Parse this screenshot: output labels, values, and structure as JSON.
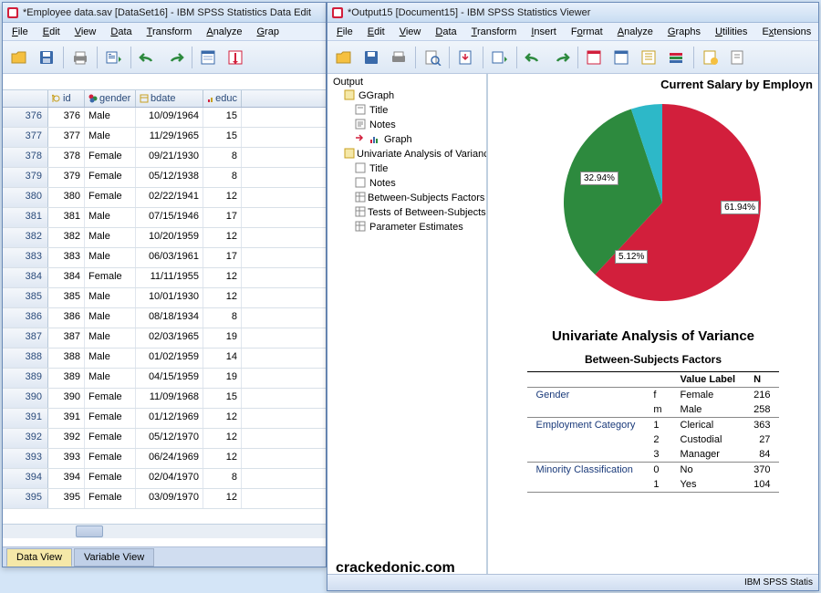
{
  "watermark": "crackedonic.com",
  "data_editor": {
    "title": "*Employee data.sav [DataSet16] - IBM SPSS Statistics Data Edit",
    "menu": [
      "File",
      "Edit",
      "View",
      "Data",
      "Transform",
      "Analyze",
      "Grap"
    ],
    "columns": [
      "id",
      "gender",
      "bdate",
      "educ"
    ],
    "rows": [
      {
        "n": 376,
        "id": 376,
        "gender": "Male",
        "bdate": "10/09/1964",
        "educ": 15
      },
      {
        "n": 377,
        "id": 377,
        "gender": "Male",
        "bdate": "11/29/1965",
        "educ": 15
      },
      {
        "n": 378,
        "id": 378,
        "gender": "Female",
        "bdate": "09/21/1930",
        "educ": 8
      },
      {
        "n": 379,
        "id": 379,
        "gender": "Female",
        "bdate": "05/12/1938",
        "educ": 8
      },
      {
        "n": 380,
        "id": 380,
        "gender": "Female",
        "bdate": "02/22/1941",
        "educ": 12
      },
      {
        "n": 381,
        "id": 381,
        "gender": "Male",
        "bdate": "07/15/1946",
        "educ": 17
      },
      {
        "n": 382,
        "id": 382,
        "gender": "Male",
        "bdate": "10/20/1959",
        "educ": 12
      },
      {
        "n": 383,
        "id": 383,
        "gender": "Male",
        "bdate": "06/03/1961",
        "educ": 17
      },
      {
        "n": 384,
        "id": 384,
        "gender": "Female",
        "bdate": "11/11/1955",
        "educ": 12
      },
      {
        "n": 385,
        "id": 385,
        "gender": "Male",
        "bdate": "10/01/1930",
        "educ": 12
      },
      {
        "n": 386,
        "id": 386,
        "gender": "Male",
        "bdate": "08/18/1934",
        "educ": 8
      },
      {
        "n": 387,
        "id": 387,
        "gender": "Male",
        "bdate": "02/03/1965",
        "educ": 19
      },
      {
        "n": 388,
        "id": 388,
        "gender": "Male",
        "bdate": "01/02/1959",
        "educ": 14
      },
      {
        "n": 389,
        "id": 389,
        "gender": "Male",
        "bdate": "04/15/1959",
        "educ": 19
      },
      {
        "n": 390,
        "id": 390,
        "gender": "Female",
        "bdate": "11/09/1968",
        "educ": 15
      },
      {
        "n": 391,
        "id": 391,
        "gender": "Female",
        "bdate": "01/12/1969",
        "educ": 12
      },
      {
        "n": 392,
        "id": 392,
        "gender": "Female",
        "bdate": "05/12/1970",
        "educ": 12
      },
      {
        "n": 393,
        "id": 393,
        "gender": "Female",
        "bdate": "06/24/1969",
        "educ": 12
      },
      {
        "n": 394,
        "id": 394,
        "gender": "Female",
        "bdate": "02/04/1970",
        "educ": 8
      },
      {
        "n": 395,
        "id": 395,
        "gender": "Female",
        "bdate": "03/09/1970",
        "educ": 12
      }
    ],
    "tabs": {
      "active": "Data View",
      "inactive": "Variable View"
    }
  },
  "viewer": {
    "title": "*Output15 [Document15] - IBM SPSS Statistics Viewer",
    "menu": [
      "File",
      "Edit",
      "View",
      "Data",
      "Transform",
      "Insert",
      "Format",
      "Analyze",
      "Graphs",
      "Utilities",
      "Extensions"
    ],
    "outline": {
      "root": "Output",
      "ggraph": {
        "label": "GGraph",
        "children": [
          "Title",
          "Notes",
          "Graph"
        ]
      },
      "anova": {
        "label": "Univariate Analysis of Variance",
        "children": [
          "Title",
          "Notes",
          "Between-Subjects Factors",
          "Tests of Between-Subjects",
          "Parameter Estimates"
        ]
      }
    },
    "chart_title": "Current Salary by Employn",
    "section_title": "Univariate Analysis of Variance",
    "factors_caption": "Between-Subjects Factors",
    "factors_header": {
      "vl": "Value Label",
      "n": "N"
    },
    "factors": [
      {
        "group": "Gender",
        "rows": [
          {
            "code": "f",
            "label": "Female",
            "n": 216
          },
          {
            "code": "m",
            "label": "Male",
            "n": 258
          }
        ]
      },
      {
        "group": "Employment Category",
        "rows": [
          {
            "code": "1",
            "label": "Clerical",
            "n": 363
          },
          {
            "code": "2",
            "label": "Custodial",
            "n": 27
          },
          {
            "code": "3",
            "label": "Manager",
            "n": 84
          }
        ]
      },
      {
        "group": "Minority Classification",
        "rows": [
          {
            "code": "0",
            "label": "No",
            "n": 370
          },
          {
            "code": "1",
            "label": "Yes",
            "n": 104
          }
        ]
      }
    ],
    "status": "IBM SPSS Statis"
  },
  "chart_data": {
    "type": "pie",
    "title": "Current Salary by Employment Category",
    "slices": [
      {
        "label": "61.94%",
        "value": 61.94,
        "color": "#d21f3c"
      },
      {
        "label": "32.94%",
        "value": 32.94,
        "color": "#2d8a3e"
      },
      {
        "label": "5.12%",
        "value": 5.12,
        "color": "#2db8c8"
      }
    ]
  },
  "colors": {
    "accent": "#2a5a9a",
    "pie_red": "#d21f3c",
    "pie_green": "#2d8a3e",
    "pie_cyan": "#2db8c8"
  }
}
